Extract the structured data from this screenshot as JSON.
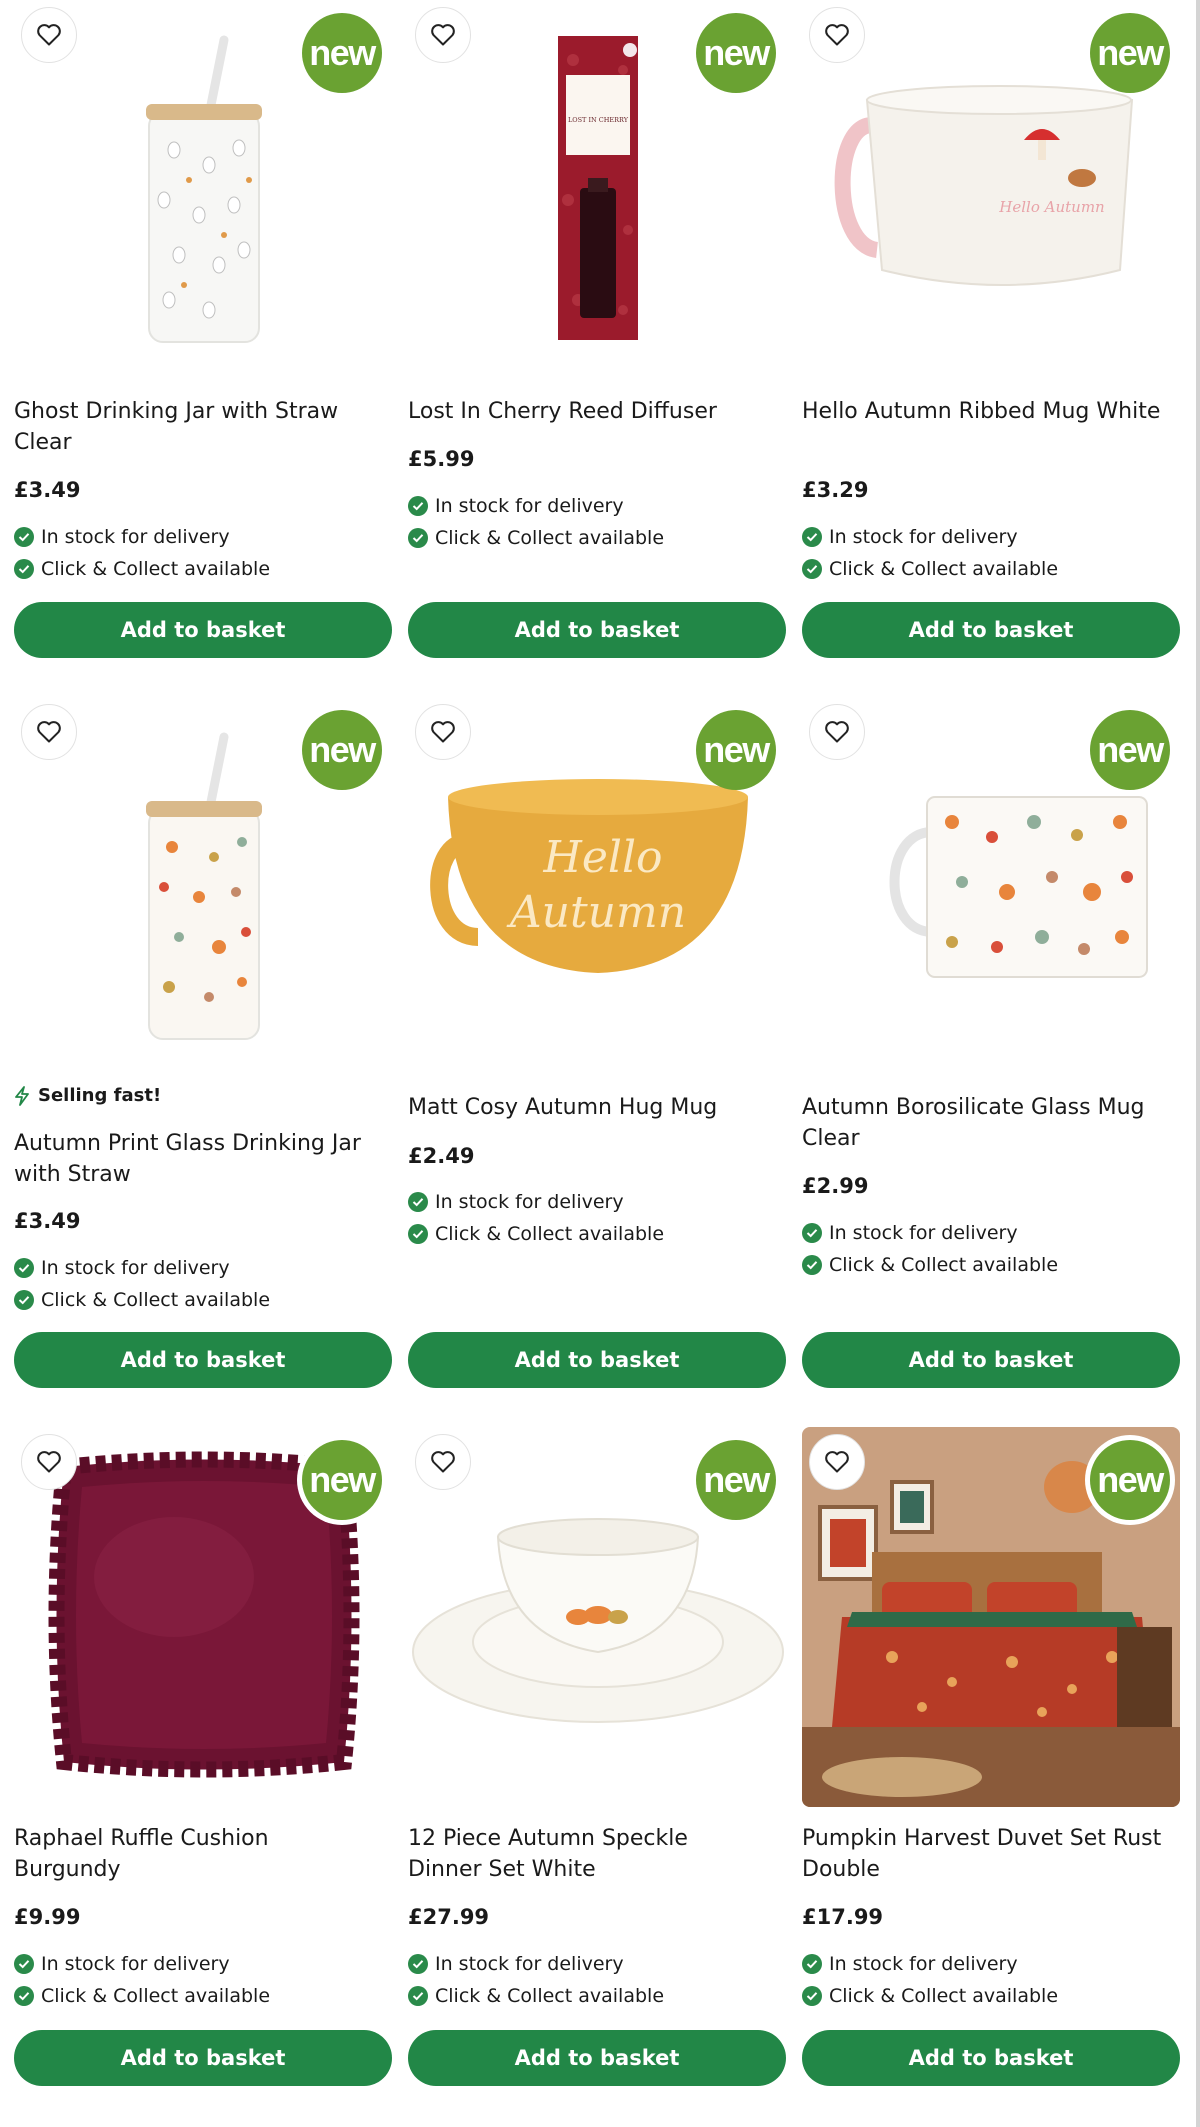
{
  "badge_label": "new",
  "colors": {
    "accent": "#228747",
    "badge": "#6aa232",
    "tick": "#2a8a4a"
  },
  "icons": {
    "wishlist": "heart-outline-icon",
    "stock": "check-circle-icon",
    "selling": "lightning-icon"
  },
  "products": [
    {
      "title": "Ghost Drinking Jar with Straw Clear",
      "price": "£3.49",
      "stock_delivery": "In stock for delivery",
      "stock_collect": "Click & Collect available",
      "button": "Add to basket"
    },
    {
      "title": "Lost In Cherry Reed Diffuser",
      "price": "£5.99",
      "stock_delivery": "In stock for delivery",
      "stock_collect": "Click & Collect available",
      "button": "Add to basket",
      "box_label": "LOST IN CHERRY"
    },
    {
      "title": "Hello Autumn Ribbed Mug White",
      "price": "£3.29",
      "stock_delivery": "In stock for delivery",
      "stock_collect": "Click & Collect available",
      "button": "Add to basket",
      "mug_text": "Hello Autumn"
    },
    {
      "selling_fast": "Selling fast!",
      "title": "Autumn Print Glass Drinking Jar with Straw",
      "price": "£3.49",
      "stock_delivery": "In stock for delivery",
      "stock_collect": "Click & Collect available",
      "button": "Add to basket"
    },
    {
      "title": "Matt Cosy Autumn Hug Mug",
      "price": "£2.49",
      "stock_delivery": "In stock for delivery",
      "stock_collect": "Click & Collect available",
      "button": "Add to basket",
      "mug_text_1": "Hello",
      "mug_text_2": "Autumn"
    },
    {
      "title": "Autumn Borosilicate Glass Mug Clear",
      "price": "£2.99",
      "stock_delivery": "In stock for delivery",
      "stock_collect": "Click & Collect available",
      "button": "Add to basket"
    },
    {
      "title": "Raphael Ruffle Cushion Burgundy",
      "price": "£9.99",
      "stock_delivery": "In stock for delivery",
      "stock_collect": "Click & Collect available",
      "button": "Add to basket"
    },
    {
      "title": "12 Piece Autumn Speckle Dinner Set White",
      "price": "£27.99",
      "stock_delivery": "In stock for delivery",
      "stock_collect": "Click & Collect available",
      "button": "Add to basket"
    },
    {
      "title": "Pumpkin Harvest Duvet Set Rust Double",
      "price": "£17.99",
      "stock_delivery": "In stock for delivery",
      "stock_collect": "Click & Collect available",
      "button": "Add to basket"
    }
  ]
}
